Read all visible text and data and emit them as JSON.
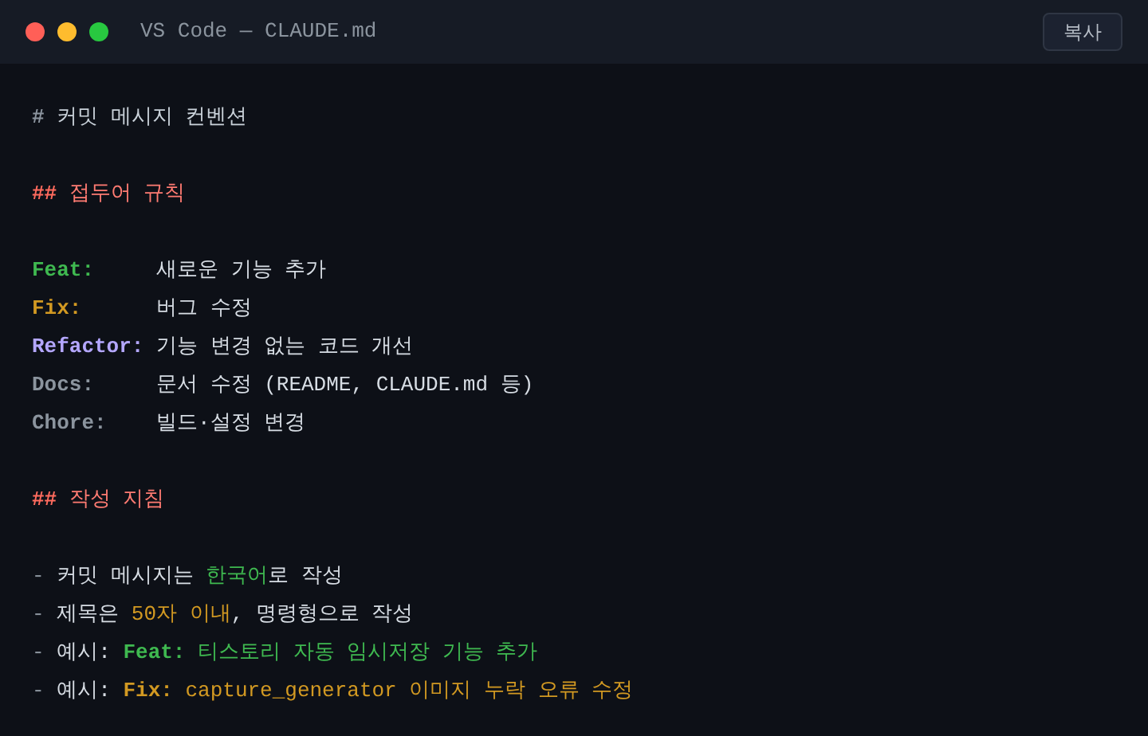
{
  "window": {
    "title": "VS Code — CLAUDE.md",
    "copy_button": "복사"
  },
  "blocks": [
    {
      "lines": [
        [
          {
            "text": "#",
            "kind": "mark",
            "color": "#8b949e"
          },
          {
            "text": " 커밋 메시지 컨벤션",
            "kind": "text",
            "color": "#c9d1d9"
          }
        ]
      ]
    },
    {
      "lines": [
        [
          {
            "text": "##",
            "kind": "mark",
            "color": "#ff6b5e"
          },
          {
            "text": " 접두어 규칙",
            "kind": "text",
            "color": "#ff7b72"
          }
        ]
      ]
    },
    {
      "lines": [
        [
          {
            "text": "Feat:",
            "kind": "label",
            "color": "#3fb950"
          },
          {
            "text": "새로운 기능 추가",
            "kind": "text",
            "color": "#d7dde4"
          }
        ],
        [
          {
            "text": "Fix:",
            "kind": "label",
            "color": "#d29922"
          },
          {
            "text": "버그 수정",
            "kind": "text",
            "color": "#d7dde4"
          }
        ],
        [
          {
            "text": "Refactor:",
            "kind": "label",
            "color": "#b4a7ff"
          },
          {
            "text": "기능 변경 없는 코드 개선",
            "kind": "text",
            "color": "#d7dde4"
          }
        ],
        [
          {
            "text": "Docs:",
            "kind": "label",
            "color": "#8b949e"
          },
          {
            "text": "문서 수정 (README, CLAUDE.md 등)",
            "kind": "text",
            "color": "#d7dde4"
          }
        ],
        [
          {
            "text": "Chore:",
            "kind": "label",
            "color": "#8b949e"
          },
          {
            "text": "빌드·설정 변경",
            "kind": "text",
            "color": "#d7dde4"
          }
        ]
      ]
    },
    {
      "lines": [
        [
          {
            "text": "##",
            "kind": "mark",
            "color": "#ff6b5e"
          },
          {
            "text": " 작성 지침",
            "kind": "text",
            "color": "#ff7b72"
          }
        ]
      ]
    },
    {
      "lines": [
        [
          {
            "text": "-",
            "kind": "text",
            "color": "#8b949e"
          },
          {
            "text": " 커밋 메시지는 ",
            "kind": "text",
            "color": "#d7dde4"
          },
          {
            "text": "한국어",
            "kind": "text",
            "color": "#3fb950"
          },
          {
            "text": "로 작성",
            "kind": "text",
            "color": "#d7dde4"
          }
        ],
        [
          {
            "text": "-",
            "kind": "text",
            "color": "#8b949e"
          },
          {
            "text": " 제목은 ",
            "kind": "text",
            "color": "#d7dde4"
          },
          {
            "text": "50자 이내",
            "kind": "text",
            "color": "#d29922"
          },
          {
            "text": ", 명령형으로 작성",
            "kind": "text",
            "color": "#d7dde4"
          }
        ],
        [
          {
            "text": "-",
            "kind": "text",
            "color": "#8b949e"
          },
          {
            "text": " 예시: ",
            "kind": "text",
            "color": "#d7dde4"
          },
          {
            "text": "Feat:",
            "kind": "mark",
            "color": "#3fb950"
          },
          {
            "text": " 티스토리 자동 임시저장 기능 추가",
            "kind": "text",
            "color": "#3fb950"
          }
        ],
        [
          {
            "text": "-",
            "kind": "text",
            "color": "#8b949e"
          },
          {
            "text": " 예시: ",
            "kind": "text",
            "color": "#d7dde4"
          },
          {
            "text": "Fix:",
            "kind": "mark",
            "color": "#d29922"
          },
          {
            "text": " capture_generator 이미지 누락 오류 수정",
            "kind": "text",
            "color": "#d29922"
          }
        ]
      ]
    }
  ]
}
